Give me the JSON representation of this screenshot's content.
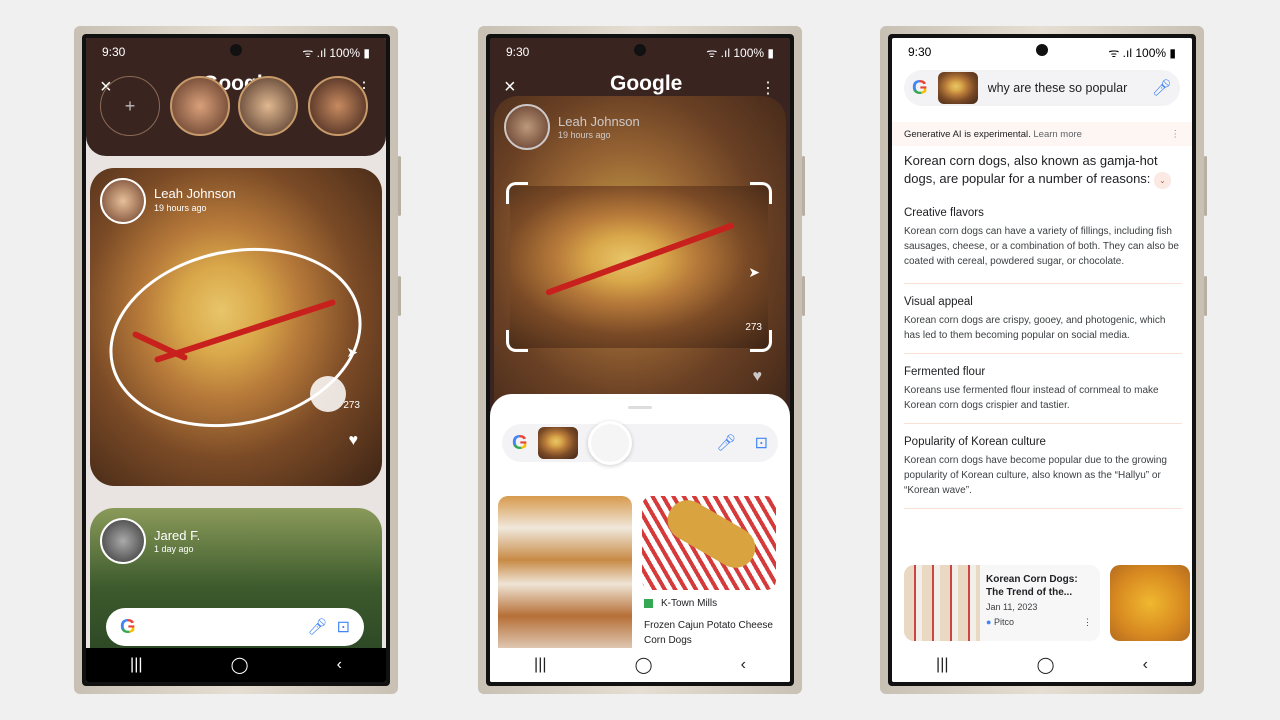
{
  "status": {
    "time": "9:30",
    "battery": "100%",
    "signal_icons": "wifi-signal-icon"
  },
  "phone1": {
    "header": {
      "logo": "Google",
      "close": "×",
      "add": "+",
      "more": "⋮"
    },
    "post1": {
      "name": "Leah Johnson",
      "time": "19 hours ago",
      "comments": "273"
    },
    "post2": {
      "name": "Jared F.",
      "time": "1 day ago"
    },
    "search": {
      "logo": "G"
    }
  },
  "phone2": {
    "header": {
      "logo": "Google",
      "close": "×",
      "more": "⋮"
    },
    "post": {
      "name": "Leah Johnson",
      "time": "19 hours ago",
      "comments": "273"
    },
    "search": {
      "logo": "G"
    },
    "results": [
      {
        "source": "K-Town Mills",
        "title": "Frozen Cajun Potato Cheese Corn Dogs",
        "source_color": "#34a853"
      }
    ]
  },
  "phone3": {
    "search": {
      "logo": "G",
      "query": "why are these so popular"
    },
    "notice": {
      "text": "Generative AI is experimental.",
      "link": "Learn more"
    },
    "intro": "Korean corn dogs, also known as gamja-hot dogs, are popular for a number of reasons:",
    "sections": [
      {
        "title": "Creative flavors",
        "body": "Korean corn dogs can have a variety of fillings, including fish sausages, cheese, or a combination of both. They can also be coated with cereal, powdered sugar, or chocolate."
      },
      {
        "title": "Visual appeal",
        "body": "Korean corn dogs are crispy, gooey, and photogenic, which has led to them becoming popular on social media."
      },
      {
        "title": "Fermented flour",
        "body": "Koreans use fermented flour instead of cornmeal to make Korean corn dogs crispier and tastier."
      },
      {
        "title": "Popularity of Korean culture",
        "body": "Korean corn dogs have become popular due to the growing popularity of Korean culture, also known as the “Hallyu” or “Korean wave”."
      }
    ],
    "card": {
      "title": "Korean Corn Dogs: The Trend of the...",
      "date": "Jan 11, 2023",
      "source": "Pitco"
    }
  },
  "nav": {
    "recents": "|||",
    "home": "◯",
    "back": "‹"
  },
  "colors": {
    "accent_link": "#5f6368",
    "divider": "#fbe0d6",
    "google_blue": "#4285f4"
  }
}
